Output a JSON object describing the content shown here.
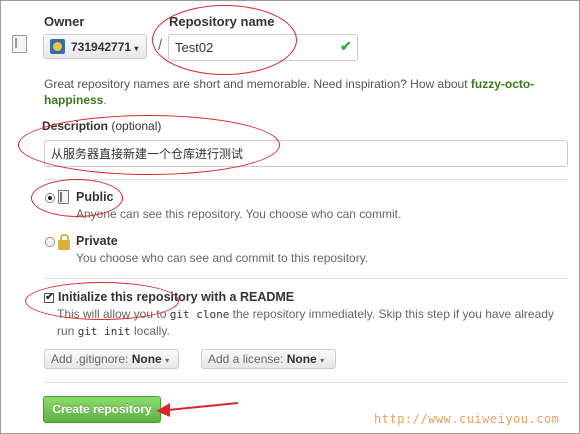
{
  "owner": {
    "label": "Owner",
    "name": "731942771",
    "caret": "▾",
    "icon": "owner-avatar"
  },
  "separator": "/",
  "repository": {
    "label": "Repository name",
    "value": "Test02",
    "valid_icon": "check-icon"
  },
  "hint": {
    "text": "Great repository names are short and memorable. Need inspiration? How about ",
    "suggestion": "fuzzy-octo-happiness",
    "end": "."
  },
  "description": {
    "label": "Description",
    "optional": " (optional)",
    "value": "从服务器直接新建一个仓库进行测试"
  },
  "visibility": {
    "public": {
      "title": "Public",
      "desc": "Anyone can see this repository. You choose who can commit.",
      "selected": true
    },
    "private": {
      "title": "Private",
      "desc": "You choose who can see and commit to this repository.",
      "selected": false
    }
  },
  "init": {
    "label": "Initialize this repository with a README",
    "checked": true,
    "desc_1": "This will allow you to ",
    "code_1": "git clone",
    "desc_2": " the repository immediately. Skip this step if you have already run ",
    "code_2": "git init",
    "desc_3": " locally."
  },
  "gitignore": {
    "prefix": "Add .gitignore: ",
    "value": "None"
  },
  "license": {
    "prefix": "Add a license: ",
    "value": "None"
  },
  "create_label": "Create repository",
  "watermark": "http://www.cuiweiyou.com",
  "colors": {
    "annotation": "#d9262a",
    "create_button": "#60b044",
    "suggestion": "#3a7a1e"
  }
}
